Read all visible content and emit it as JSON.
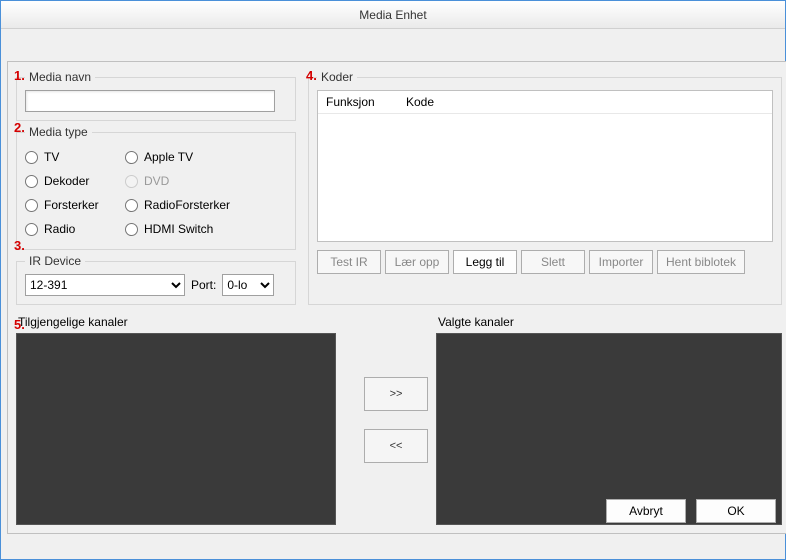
{
  "title": "Media Enhet",
  "nums": {
    "n1": "1.",
    "n2": "2.",
    "n3": "3.",
    "n4": "4.",
    "n5": "5."
  },
  "media_navn": {
    "legend": "Media navn",
    "value": ""
  },
  "media_type": {
    "legend": "Media type",
    "col1": [
      "TV",
      "Dekoder",
      "Forsterker",
      "Radio"
    ],
    "col2": [
      "Apple TV",
      "DVD",
      "RadioForsterker",
      "HDMI Switch"
    ]
  },
  "ir": {
    "legend": "IR Device",
    "device": "12-391",
    "port_label": "Port:",
    "port": "0-lo"
  },
  "koder": {
    "legend": "Koder",
    "headers": {
      "funksjon": "Funksjon",
      "kode": "Kode"
    },
    "buttons": {
      "test": "Test IR",
      "laer": "Lær opp",
      "legg": "Legg til",
      "slett": "Slett",
      "importer": "Importer",
      "hent": "Hent biblotek"
    }
  },
  "kanaler": {
    "tilgjengelige": "Tilgjengelige kanaler",
    "valgte": "Valgte kanaler",
    "add": ">>",
    "remove": "<<"
  },
  "dialog": {
    "avbryt": "Avbryt",
    "ok": "OK"
  }
}
